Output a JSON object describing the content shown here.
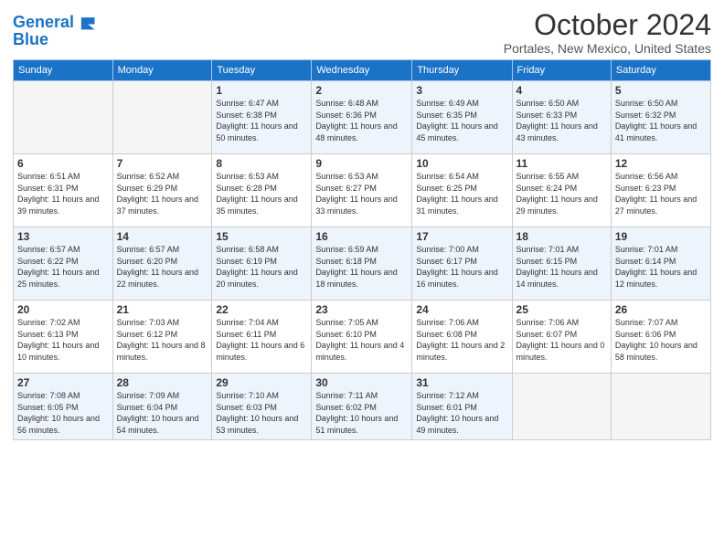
{
  "header": {
    "logo_line1": "General",
    "logo_line2": "Blue",
    "month": "October 2024",
    "location": "Portales, New Mexico, United States"
  },
  "days_of_week": [
    "Sunday",
    "Monday",
    "Tuesday",
    "Wednesday",
    "Thursday",
    "Friday",
    "Saturday"
  ],
  "weeks": [
    [
      {
        "day": "",
        "info": ""
      },
      {
        "day": "",
        "info": ""
      },
      {
        "day": "1",
        "info": "Sunrise: 6:47 AM\nSunset: 6:38 PM\nDaylight: 11 hours and 50 minutes."
      },
      {
        "day": "2",
        "info": "Sunrise: 6:48 AM\nSunset: 6:36 PM\nDaylight: 11 hours and 48 minutes."
      },
      {
        "day": "3",
        "info": "Sunrise: 6:49 AM\nSunset: 6:35 PM\nDaylight: 11 hours and 45 minutes."
      },
      {
        "day": "4",
        "info": "Sunrise: 6:50 AM\nSunset: 6:33 PM\nDaylight: 11 hours and 43 minutes."
      },
      {
        "day": "5",
        "info": "Sunrise: 6:50 AM\nSunset: 6:32 PM\nDaylight: 11 hours and 41 minutes."
      }
    ],
    [
      {
        "day": "6",
        "info": "Sunrise: 6:51 AM\nSunset: 6:31 PM\nDaylight: 11 hours and 39 minutes."
      },
      {
        "day": "7",
        "info": "Sunrise: 6:52 AM\nSunset: 6:29 PM\nDaylight: 11 hours and 37 minutes."
      },
      {
        "day": "8",
        "info": "Sunrise: 6:53 AM\nSunset: 6:28 PM\nDaylight: 11 hours and 35 minutes."
      },
      {
        "day": "9",
        "info": "Sunrise: 6:53 AM\nSunset: 6:27 PM\nDaylight: 11 hours and 33 minutes."
      },
      {
        "day": "10",
        "info": "Sunrise: 6:54 AM\nSunset: 6:25 PM\nDaylight: 11 hours and 31 minutes."
      },
      {
        "day": "11",
        "info": "Sunrise: 6:55 AM\nSunset: 6:24 PM\nDaylight: 11 hours and 29 minutes."
      },
      {
        "day": "12",
        "info": "Sunrise: 6:56 AM\nSunset: 6:23 PM\nDaylight: 11 hours and 27 minutes."
      }
    ],
    [
      {
        "day": "13",
        "info": "Sunrise: 6:57 AM\nSunset: 6:22 PM\nDaylight: 11 hours and 25 minutes."
      },
      {
        "day": "14",
        "info": "Sunrise: 6:57 AM\nSunset: 6:20 PM\nDaylight: 11 hours and 22 minutes."
      },
      {
        "day": "15",
        "info": "Sunrise: 6:58 AM\nSunset: 6:19 PM\nDaylight: 11 hours and 20 minutes."
      },
      {
        "day": "16",
        "info": "Sunrise: 6:59 AM\nSunset: 6:18 PM\nDaylight: 11 hours and 18 minutes."
      },
      {
        "day": "17",
        "info": "Sunrise: 7:00 AM\nSunset: 6:17 PM\nDaylight: 11 hours and 16 minutes."
      },
      {
        "day": "18",
        "info": "Sunrise: 7:01 AM\nSunset: 6:15 PM\nDaylight: 11 hours and 14 minutes."
      },
      {
        "day": "19",
        "info": "Sunrise: 7:01 AM\nSunset: 6:14 PM\nDaylight: 11 hours and 12 minutes."
      }
    ],
    [
      {
        "day": "20",
        "info": "Sunrise: 7:02 AM\nSunset: 6:13 PM\nDaylight: 11 hours and 10 minutes."
      },
      {
        "day": "21",
        "info": "Sunrise: 7:03 AM\nSunset: 6:12 PM\nDaylight: 11 hours and 8 minutes."
      },
      {
        "day": "22",
        "info": "Sunrise: 7:04 AM\nSunset: 6:11 PM\nDaylight: 11 hours and 6 minutes."
      },
      {
        "day": "23",
        "info": "Sunrise: 7:05 AM\nSunset: 6:10 PM\nDaylight: 11 hours and 4 minutes."
      },
      {
        "day": "24",
        "info": "Sunrise: 7:06 AM\nSunset: 6:08 PM\nDaylight: 11 hours and 2 minutes."
      },
      {
        "day": "25",
        "info": "Sunrise: 7:06 AM\nSunset: 6:07 PM\nDaylight: 11 hours and 0 minutes."
      },
      {
        "day": "26",
        "info": "Sunrise: 7:07 AM\nSunset: 6:06 PM\nDaylight: 10 hours and 58 minutes."
      }
    ],
    [
      {
        "day": "27",
        "info": "Sunrise: 7:08 AM\nSunset: 6:05 PM\nDaylight: 10 hours and 56 minutes."
      },
      {
        "day": "28",
        "info": "Sunrise: 7:09 AM\nSunset: 6:04 PM\nDaylight: 10 hours and 54 minutes."
      },
      {
        "day": "29",
        "info": "Sunrise: 7:10 AM\nSunset: 6:03 PM\nDaylight: 10 hours and 53 minutes."
      },
      {
        "day": "30",
        "info": "Sunrise: 7:11 AM\nSunset: 6:02 PM\nDaylight: 10 hours and 51 minutes."
      },
      {
        "day": "31",
        "info": "Sunrise: 7:12 AM\nSunset: 6:01 PM\nDaylight: 10 hours and 49 minutes."
      },
      {
        "day": "",
        "info": ""
      },
      {
        "day": "",
        "info": ""
      }
    ]
  ]
}
